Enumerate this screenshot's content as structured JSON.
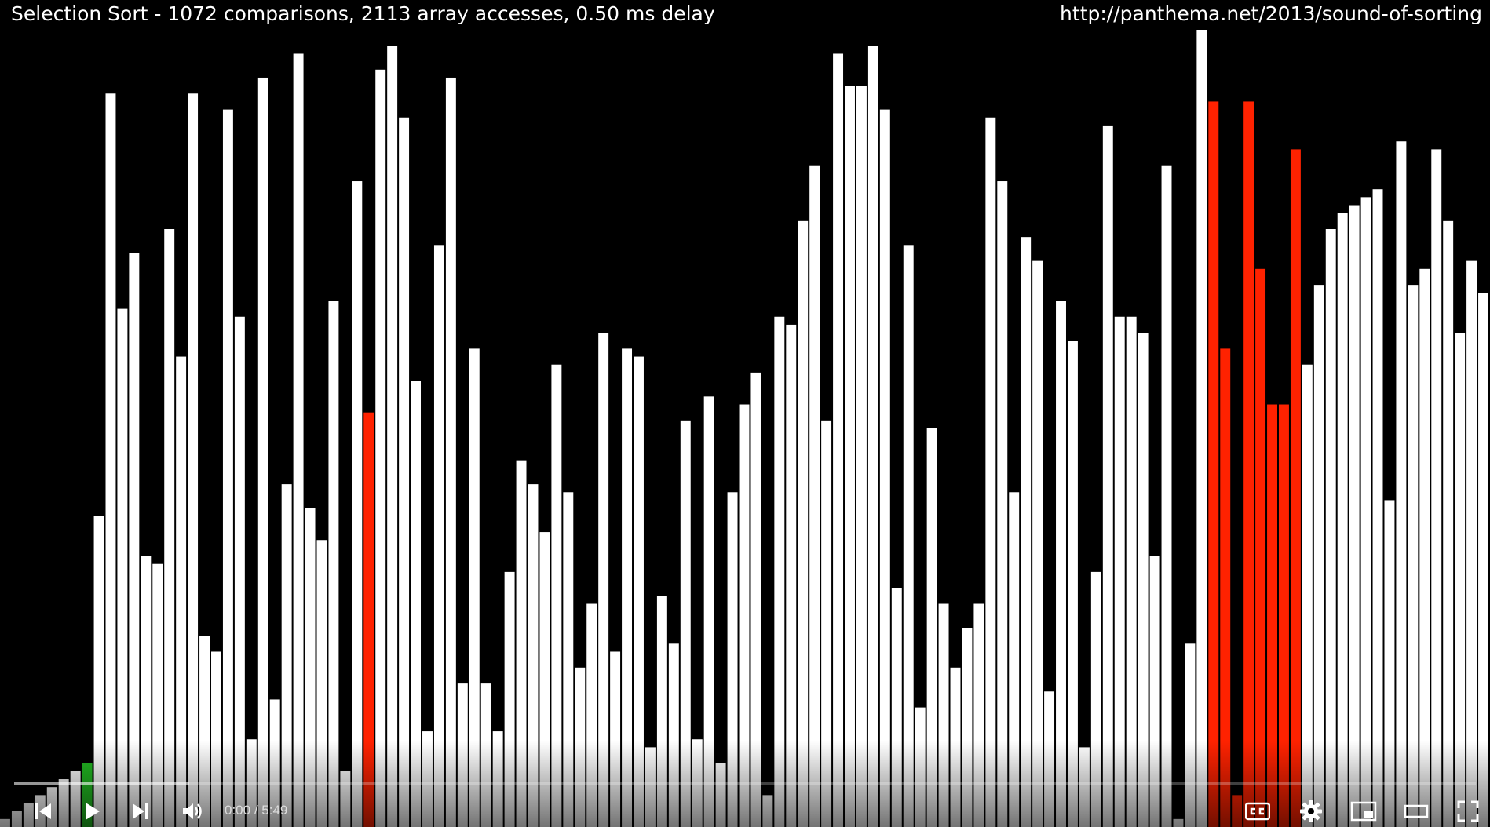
{
  "overlay": {
    "title": "Selection Sort - 1072 comparisons, 2113 array accesses, 0.50 ms delay",
    "url": "http://panthema.net/2013/sound-of-sorting"
  },
  "colors": {
    "background": "#000000",
    "bar_default": "#ffffff",
    "bar_compare": "#ff2200",
    "bar_sorted": "#22bb22",
    "progress_played": "#ff0000"
  },
  "chart_data": {
    "type": "bar",
    "ylim": [
      0,
      100
    ],
    "values": [
      1,
      2,
      3,
      4,
      5,
      6,
      7,
      8,
      39,
      92,
      65,
      72,
      34,
      33,
      75,
      59,
      92,
      24,
      22,
      90,
      64,
      11,
      94,
      16,
      43,
      97,
      40,
      36,
      66,
      7,
      81,
      52,
      95,
      98,
      89,
      56,
      12,
      73,
      94,
      18,
      60,
      18,
      12,
      32,
      46,
      43,
      37,
      58,
      42,
      20,
      28,
      62,
      22,
      60,
      59,
      10,
      29,
      23,
      51,
      11,
      54,
      8,
      42,
      53,
      57,
      4,
      64,
      63,
      76,
      83,
      51,
      97,
      93,
      93,
      98,
      90,
      30,
      73,
      15,
      50,
      28,
      20,
      25,
      28,
      89,
      81,
      42,
      74,
      71,
      17,
      66,
      61,
      10,
      32,
      88,
      64,
      64,
      62,
      34,
      83,
      1,
      23,
      102,
      91,
      60,
      4,
      91,
      70,
      53,
      53,
      85,
      58,
      68,
      75,
      77,
      78,
      79,
      80,
      41,
      86,
      68,
      70,
      85,
      76,
      62,
      71,
      67
    ],
    "compare_indices": [
      103,
      104,
      105,
      106,
      107,
      108,
      109,
      110
    ],
    "sorted_indices": [
      7
    ],
    "highlight_indices": [
      31
    ]
  },
  "player": {
    "progress_fraction": 0.0,
    "loaded_fraction": 0.12,
    "time_current": "0:00",
    "time_separator": " / ",
    "time_total": "5:49",
    "icons": {
      "previous": "skip-previous-icon",
      "play": "play-icon",
      "next": "skip-next-icon",
      "volume": "volume-icon",
      "captions": "captions-icon",
      "settings": "gear-icon",
      "miniplayer": "miniplayer-icon",
      "theater": "theater-mode-icon",
      "fullscreen": "fullscreen-icon"
    }
  }
}
